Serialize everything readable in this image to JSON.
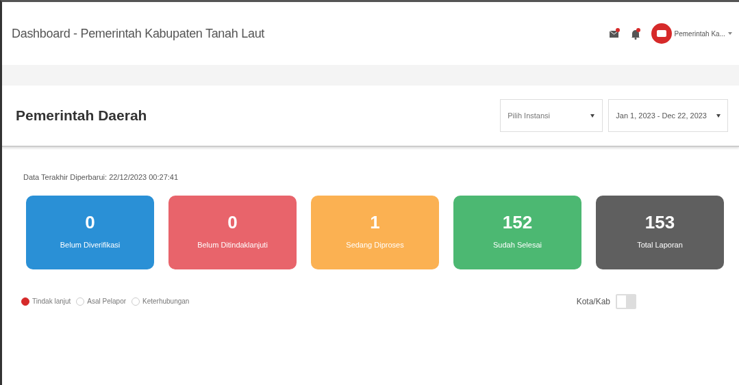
{
  "topbar": {
    "title": "Dashboard - Pemerintah Kabupaten Tanah Laut",
    "user": "Pemerintah Ka..."
  },
  "panel": {
    "title": "Pemerintah Daerah",
    "instansi": {
      "placeholder": "Pilih Instansi"
    },
    "date_range": "Jan 1, 2023 - Dec 22, 2023"
  },
  "updated": "Data Terakhir Diperbarui: 22/12/2023 00:27:41",
  "stats": [
    {
      "value": "0",
      "label": "Belum Diverifikasi",
      "color": "#2a90d6"
    },
    {
      "value": "0",
      "label": "Belum Ditindaklanjuti",
      "color": "#e8646b"
    },
    {
      "value": "1",
      "label": "Sedang Diproses",
      "color": "#fbb152"
    },
    {
      "value": "152",
      "label": "Sudah Selesai",
      "color": "#4cb872"
    },
    {
      "value": "153",
      "label": "Total Laporan",
      "color": "#5f5f5f"
    }
  ],
  "filters": [
    {
      "label": "Tindak lanjut",
      "selected": true
    },
    {
      "label": "Asal Pelapor",
      "selected": false
    },
    {
      "label": "Keterhubungan",
      "selected": false
    }
  ],
  "toggle": {
    "label": "Kota/Kab",
    "on": false
  }
}
